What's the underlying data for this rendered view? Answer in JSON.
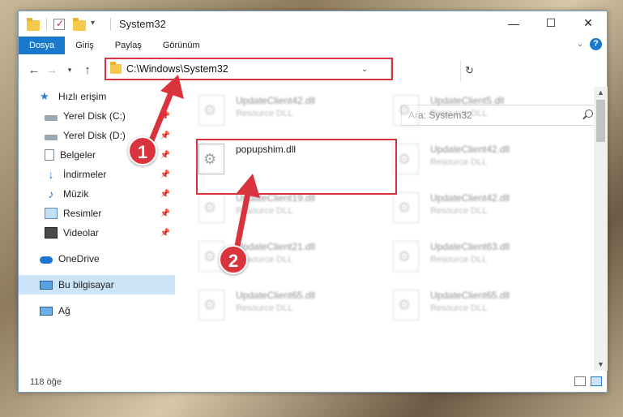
{
  "window": {
    "title": "System32",
    "quick_access_icons": [
      "folder-icon",
      "properties-icon",
      "new-folder-icon"
    ]
  },
  "ribbon": {
    "tabs": [
      {
        "label": "Dosya",
        "active": true
      },
      {
        "label": "Giriş",
        "active": false
      },
      {
        "label": "Paylaş",
        "active": false
      },
      {
        "label": "Görünüm",
        "active": false
      }
    ],
    "accent_color": "#1979ca"
  },
  "address": {
    "path": "C:\\Windows\\System32",
    "search_placeholder": "Ara: System32"
  },
  "nav": {
    "items": [
      {
        "label": "Hızlı erişim",
        "icon": "star-icon",
        "pinned": false
      },
      {
        "label": "Yerel Disk (C:)",
        "icon": "drive-icon",
        "pinned": true
      },
      {
        "label": "Yerel Disk (D:)",
        "icon": "drive-icon",
        "pinned": true
      },
      {
        "label": "Belgeler",
        "icon": "documents-icon",
        "pinned": true
      },
      {
        "label": "İndirmeler",
        "icon": "downloads-icon",
        "pinned": true
      },
      {
        "label": "Müzik",
        "icon": "music-icon",
        "pinned": true
      },
      {
        "label": "Resimler",
        "icon": "pictures-icon",
        "pinned": true
      },
      {
        "label": "Videolar",
        "icon": "videos-icon",
        "pinned": true
      },
      {
        "label": "OneDrive",
        "icon": "cloud-icon",
        "pinned": false
      },
      {
        "label": "Bu bilgisayar",
        "icon": "computer-icon",
        "pinned": false,
        "selected": true
      },
      {
        "label": "Ağ",
        "icon": "network-icon",
        "pinned": false
      }
    ]
  },
  "files": {
    "left_column": [
      {
        "name": "UpdateClient42.dll",
        "type": "Resource DLL"
      },
      {
        "name": "popupshim.dll",
        "type": ""
      },
      {
        "name": "UpdateClient19.dll",
        "type": "Resource DLL"
      },
      {
        "name": "UpdateClient21.dll",
        "type": "Resource DLL"
      },
      {
        "name": "UpdateClient65.dll",
        "type": "Resource DLL"
      }
    ],
    "right_column": [
      {
        "name": "UpdateClient5.dll",
        "type": "Resource DLL"
      },
      {
        "name": "UpdateClient42.dll",
        "type": "Resource DLL"
      },
      {
        "name": "UpdateClient42.dll",
        "type": "Resource DLL"
      },
      {
        "name": "UpdateClient63.dll",
        "type": "Resource DLL"
      },
      {
        "name": "UpdateClient65.dll",
        "type": "Resource DLL"
      }
    ]
  },
  "status": {
    "item_count": "118 öğe"
  },
  "callouts": {
    "step1": "1",
    "step2": "2",
    "color": "#d9343e"
  }
}
